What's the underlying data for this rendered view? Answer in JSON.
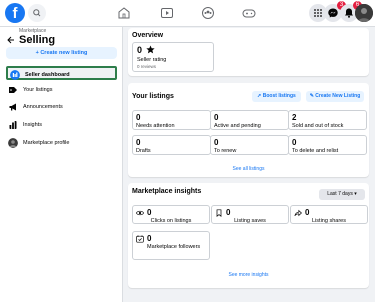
{
  "topbar": {
    "logo": "f",
    "icons": [
      "search-icon",
      "home-icon",
      "watch-icon",
      "groups-icon",
      "gaming-icon",
      "menu-grid-icon",
      "messenger-icon",
      "notifications-icon"
    ],
    "badges": {
      "messenger": "3",
      "notifications": "6"
    }
  },
  "sidebar": {
    "breadcrumb": "Marketplace",
    "title": "Selling",
    "create_button": "+ Create new listing",
    "items": [
      {
        "label": "Seller dashboard",
        "icon": "dashboard-icon"
      },
      {
        "label": "Your listings",
        "icon": "tag-icon"
      },
      {
        "label": "Announcements",
        "icon": "megaphone-icon"
      },
      {
        "label": "Insights",
        "icon": "chart-icon"
      },
      {
        "label": "Marketplace profile",
        "icon": "profile-icon"
      }
    ]
  },
  "overview": {
    "title": "Overview",
    "rating_value": "0",
    "rating_label": "Seller rating",
    "rating_sub": "0 reviews"
  },
  "listings": {
    "title": "Your listings",
    "boost_label": "Boost listings",
    "create_label": "Create New Listing",
    "stats": [
      {
        "num": "0",
        "label": "Needs attention"
      },
      {
        "num": "0",
        "label": "Active and pending"
      },
      {
        "num": "2",
        "label": "Sold and out of stock"
      },
      {
        "num": "0",
        "label": "Drafts"
      },
      {
        "num": "0",
        "label": "To renew"
      },
      {
        "num": "0",
        "label": "To delete and relist"
      }
    ],
    "see_all": "See all listings"
  },
  "insights": {
    "title": "Marketplace insights",
    "period": "Last 7 days",
    "items": [
      {
        "num": "0",
        "label": "Clicks on listings",
        "icon": "eye-icon"
      },
      {
        "num": "0",
        "label": "Listing saves",
        "icon": "bookmark-icon"
      },
      {
        "num": "0",
        "label": "Listing shares",
        "icon": "share-icon"
      },
      {
        "num": "0",
        "label": "Marketplace followers",
        "icon": "followers-icon"
      }
    ],
    "see_more": "See more insights"
  },
  "colors": {
    "accent": "#1877f2",
    "active_outline": "#2e7d4b",
    "badge": "#e41e3f"
  }
}
